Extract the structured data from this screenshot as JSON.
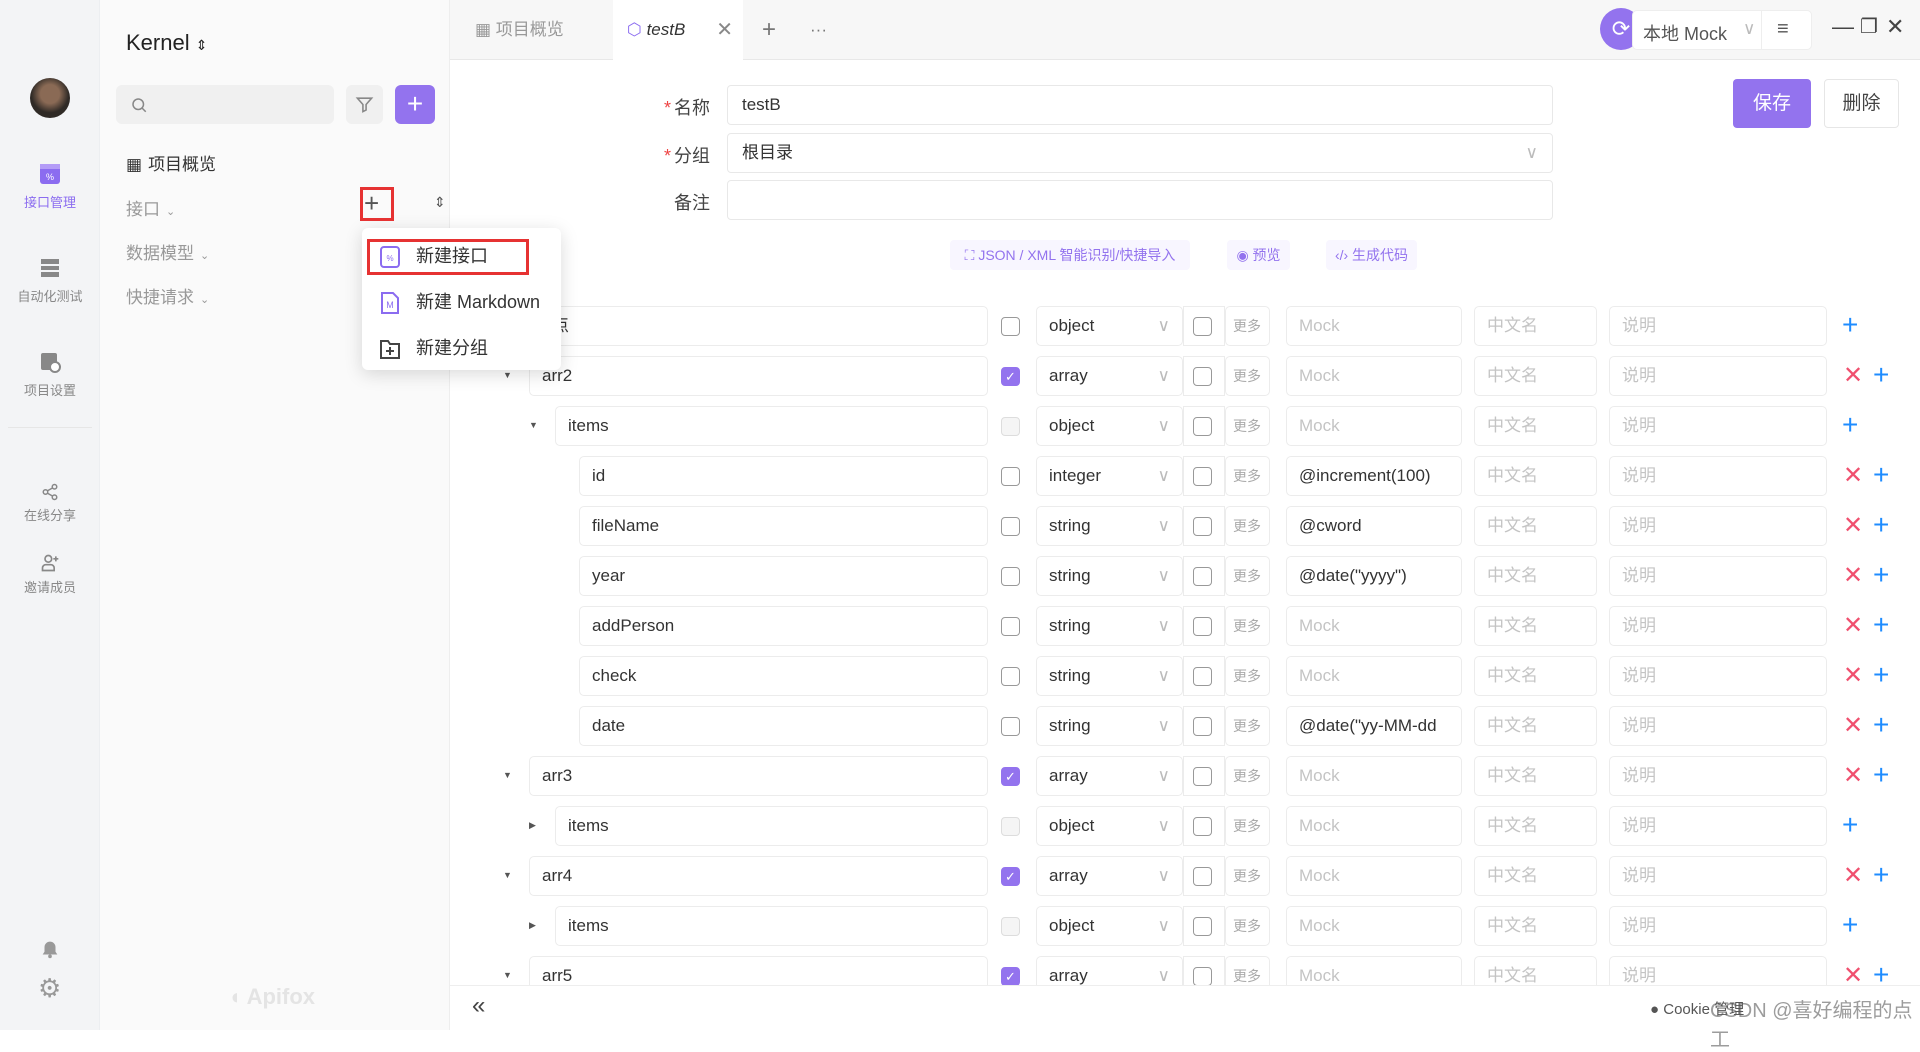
{
  "rail": {
    "items": [
      {
        "label": "接口管理",
        "icon": "api-icon",
        "active": true
      },
      {
        "label": "自动化测试",
        "icon": "automation-icon"
      },
      {
        "label": "项目设置",
        "icon": "project-settings-icon"
      },
      {
        "label": "在线分享",
        "icon": "share-icon"
      },
      {
        "label": "邀请成员",
        "icon": "invite-member-icon"
      }
    ]
  },
  "sidebar": {
    "project": "Kernel",
    "overview": "项目概览",
    "sections": [
      "接口",
      "数据模型",
      "快捷请求"
    ],
    "watermark": "Apifox"
  },
  "menu": {
    "items": [
      "新建接口",
      "新建 Markdown",
      "新建分组"
    ]
  },
  "tabs": [
    {
      "label": "项目概览"
    },
    {
      "label": "testB",
      "active": true
    }
  ],
  "topbar": {
    "env": "本地 Mock"
  },
  "form": {
    "name_label": "名称",
    "name": "testB",
    "group_label": "分组",
    "group": "根目录",
    "remark_label": "备注",
    "remark": "",
    "save": "保存",
    "delete": "删除"
  },
  "tools": [
    "JSON / XML 智能识别/快捷导入",
    "预览",
    "生成代码"
  ],
  "placeholders": {
    "mock": "Mock",
    "cn": "中文名",
    "desc": "说明",
    "more": "更多"
  },
  "rows": [
    {
      "name": "根节点",
      "level": -1,
      "caret": "",
      "req": "off",
      "type": "object",
      "mock": "",
      "del": false
    },
    {
      "name": "arr2",
      "level": 0,
      "caret": "down",
      "req": "on",
      "type": "array",
      "mock": "",
      "del": true
    },
    {
      "name": "items",
      "level": 1,
      "caret": "down",
      "req": "dis",
      "type": "object",
      "mock": "",
      "del": false
    },
    {
      "name": "id",
      "level": 2,
      "caret": "",
      "req": "off",
      "type": "integer",
      "mock": "@increment(100)",
      "del": true
    },
    {
      "name": "fileName",
      "level": 2,
      "caret": "",
      "req": "off",
      "type": "string",
      "mock": "@cword",
      "del": true
    },
    {
      "name": "year",
      "level": 2,
      "caret": "",
      "req": "off",
      "type": "string",
      "mock": "@date(\"yyyy\")",
      "del": true
    },
    {
      "name": "addPerson",
      "level": 2,
      "caret": "",
      "req": "off",
      "type": "string",
      "mock": "",
      "del": true
    },
    {
      "name": "check",
      "level": 2,
      "caret": "",
      "req": "off",
      "type": "string",
      "mock": "",
      "del": true
    },
    {
      "name": "date",
      "level": 2,
      "caret": "",
      "req": "off",
      "type": "string",
      "mock": "@date(\"yy-MM-dd",
      "del": true
    },
    {
      "name": "arr3",
      "level": 0,
      "caret": "down",
      "req": "on",
      "type": "array",
      "mock": "",
      "del": true
    },
    {
      "name": "items",
      "level": 1,
      "caret": "right",
      "req": "dis",
      "type": "object",
      "mock": "",
      "del": false
    },
    {
      "name": "arr4",
      "level": 0,
      "caret": "down",
      "req": "on",
      "type": "array",
      "mock": "",
      "del": true
    },
    {
      "name": "items",
      "level": 1,
      "caret": "right",
      "req": "dis",
      "type": "object",
      "mock": "",
      "del": false
    },
    {
      "name": "arr5",
      "level": 0,
      "caret": "down",
      "req": "on",
      "type": "array",
      "mock": "",
      "del": true
    }
  ],
  "footer": {
    "collapse": "«",
    "cookie": "Cookie 管理",
    "watermark": "CSDN @喜好编程的点工"
  },
  "colors": {
    "accent": "#9373ee",
    "delete": "#f0506e",
    "add": "#1f8cff",
    "highlight": "#e63232"
  }
}
